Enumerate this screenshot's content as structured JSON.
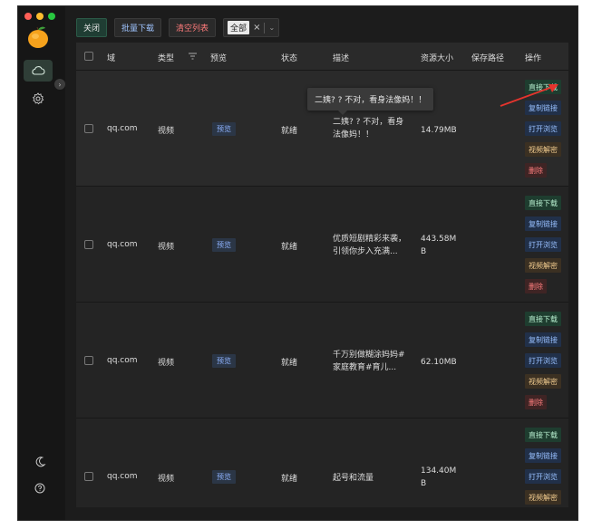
{
  "colors": {
    "accent_red": "#e5342d",
    "traffic_red": "#ff5f57",
    "traffic_yellow": "#febc2e",
    "traffic_green": "#28c840"
  },
  "sidebar": {
    "items": [
      {
        "icon": "cloud-icon",
        "active": true
      },
      {
        "icon": "gear-icon",
        "active": false
      }
    ],
    "bottom": [
      {
        "icon": "moon-icon"
      },
      {
        "icon": "help-icon"
      }
    ],
    "expand_icon": "chevron-right-icon"
  },
  "toolbar": {
    "close_label": "关闭",
    "batch_download_label": "批量下载",
    "clear_list_label": "清空列表",
    "filter_selected": "全部"
  },
  "table": {
    "columns": {
      "domain": "域",
      "type": "类型",
      "preview": "预览",
      "status": "状态",
      "description": "描述",
      "size": "资源大小",
      "save_path": "保存路径",
      "actions": "操作"
    },
    "rows": [
      {
        "domain": "qq.com",
        "type": "视频",
        "preview": "预览",
        "status": "就绪",
        "desc_line1": "二姨? ? 不对，看身",
        "desc_line2": "法像妈！！",
        "size_line1": "14.79MB",
        "size_line2": "",
        "actions": [
          "直接下载",
          "复制链接",
          "打开浏览",
          "视频解密",
          "删除"
        ]
      },
      {
        "domain": "qq.com",
        "type": "视频",
        "preview": "预览",
        "status": "就绪",
        "desc_line1": "优质短剧精彩来袭，",
        "desc_line2": "引领你步入充满...",
        "size_line1": "443.58M",
        "size_line2": "B",
        "actions": [
          "直接下载",
          "复制链接",
          "打开浏览",
          "视频解密",
          "删除"
        ]
      },
      {
        "domain": "qq.com",
        "type": "视频",
        "preview": "预览",
        "status": "就绪",
        "desc_line1": "千万别做糊涂妈妈#",
        "desc_line2": "家庭教育#育儿...",
        "size_line1": "62.10MB",
        "size_line2": "",
        "actions": [
          "直接下载",
          "复制链接",
          "打开浏览",
          "视频解密",
          "删除"
        ]
      },
      {
        "domain": "qq.com",
        "type": "视频",
        "preview": "预览",
        "status": "就绪",
        "desc_line1": "起号和流量",
        "desc_line2": "",
        "size_line1": "134.40M",
        "size_line2": "B",
        "actions": [
          "直接下载",
          "复制链接",
          "打开浏览",
          "视频解密"
        ]
      }
    ]
  },
  "tooltip": {
    "text": "二姨? ? 不对，看身法像妈！！"
  }
}
